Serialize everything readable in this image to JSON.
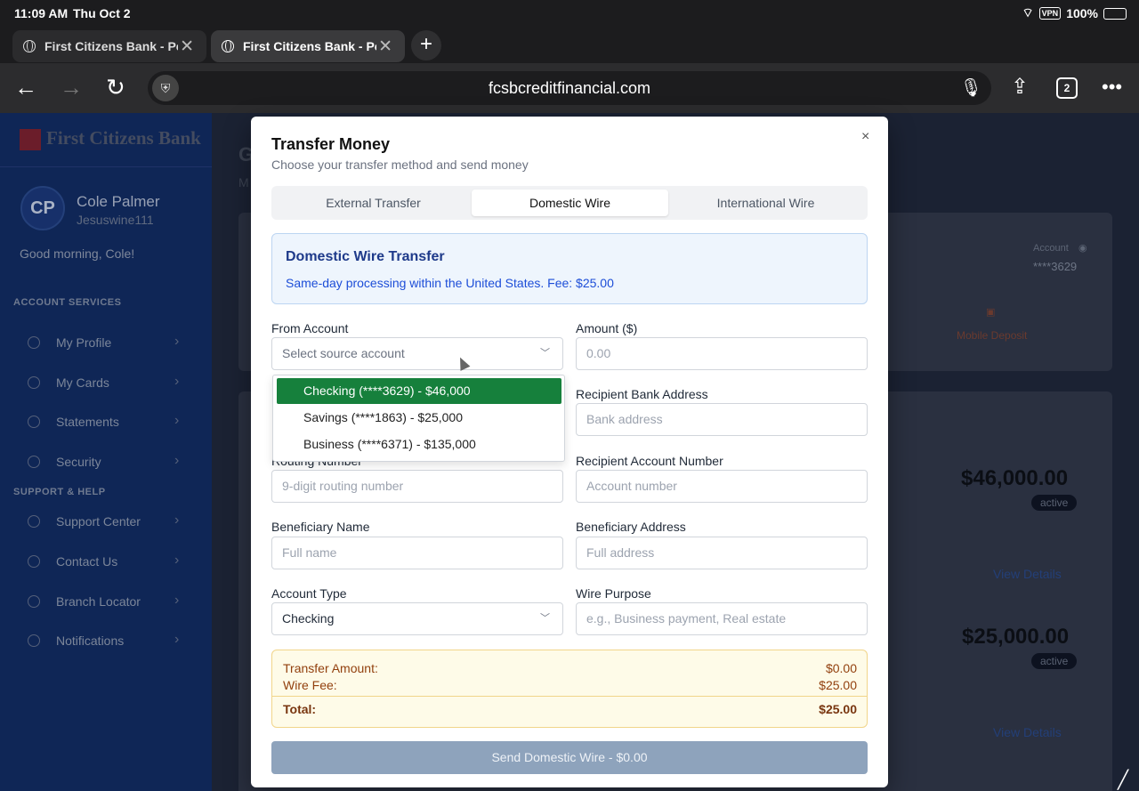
{
  "status_bar": {
    "time": "11:09 AM",
    "date": "Thu Oct 2",
    "vpn": "VPN",
    "battery": "100%"
  },
  "browser": {
    "tabs": [
      {
        "title": "First Citizens Bank - Pe"
      },
      {
        "title": "First Citizens Bank - Pe"
      }
    ],
    "tab_count": "2",
    "url": "fcsbcreditfinancial.com"
  },
  "sidebar": {
    "logo_text": "First Citizens Bank",
    "avatar_initials": "CP",
    "user_name": "Cole Palmer",
    "user_handle": "Jesuswine111",
    "greeting": "Good morning, Cole!",
    "account_services_label": "ACCOUNT SERVICES",
    "account_services": [
      "My Profile",
      "My Cards",
      "Statements",
      "Security"
    ],
    "support_label": "SUPPORT & HELP",
    "support": [
      "Support Center",
      "Contact Us",
      "Branch Locator",
      "Notifications"
    ]
  },
  "background": {
    "title": "G",
    "subtitle": "M",
    "account_label": "Account",
    "account_masked": "****3629",
    "mobile_deposit": "Mobile Deposit",
    "cards": [
      {
        "balance": "$46,000.00",
        "status": "active",
        "link": "View Details"
      },
      {
        "balance": "$25,000.00",
        "status": "active",
        "link": "View Details"
      }
    ]
  },
  "modal": {
    "title": "Transfer Money",
    "subtitle": "Choose your transfer method and send money",
    "close": "×",
    "tabs": [
      "External Transfer",
      "Domestic Wire",
      "International Wire"
    ],
    "active_tab": "Domestic Wire",
    "info": {
      "title": "Domestic Wire Transfer",
      "description": "Same-day processing within the United States. Fee: $25.00"
    },
    "from_account": {
      "label": "From Account",
      "placeholder": "Select source account",
      "options": [
        "Checking (****3629) - $46,000",
        "Savings (****1863) - $25,000",
        "Business (****6371) - $135,000"
      ],
      "highlighted_option": "Checking (****3629) - $46,000"
    },
    "amount": {
      "label": "Amount ($)",
      "placeholder": "0.00"
    },
    "recipient_bank_address": {
      "label": "Recipient Bank Address",
      "placeholder": "Bank address"
    },
    "routing_number": {
      "label": "Routing Number",
      "placeholder": "9-digit routing number"
    },
    "recipient_account_number": {
      "label": "Recipient Account Number",
      "placeholder": "Account number"
    },
    "beneficiary_name": {
      "label": "Beneficiary Name",
      "placeholder": "Full name"
    },
    "beneficiary_address": {
      "label": "Beneficiary Address",
      "placeholder": "Full address"
    },
    "account_type": {
      "label": "Account Type",
      "value": "Checking"
    },
    "wire_purpose": {
      "label": "Wire Purpose",
      "placeholder": "e.g., Business payment, Real estate"
    },
    "summary": {
      "transfer_amount_label": "Transfer Amount:",
      "transfer_amount": "$0.00",
      "wire_fee_label": "Wire Fee:",
      "wire_fee": "$25.00",
      "total_label": "Total:",
      "total": "$25.00"
    },
    "send_button": "Send Domestic Wire - $0.00"
  },
  "colors": {
    "sidebar_bg": "#0f2656",
    "selected_option": "#16803c",
    "info_title": "#1e3a8a",
    "send_button_disabled": "#8ea3bc"
  }
}
